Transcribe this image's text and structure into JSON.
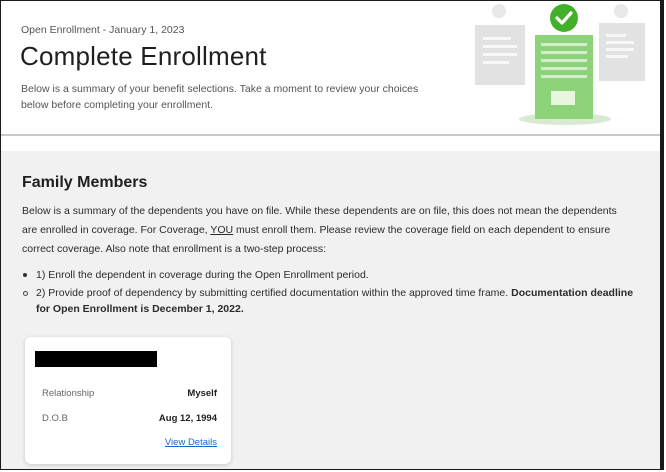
{
  "hero": {
    "eyebrow": "Open Enrollment - January 1, 2023",
    "title": "Complete Enrollment",
    "subtitle": "Below is a summary of your benefit selections. Take a moment to review your choices below before completing your enrollment."
  },
  "family": {
    "heading": "Family Members",
    "intro_1": "Below is a summary of the dependents you have on file. While these dependents are on file, this does not mean the dependents are enrolled in coverage. For Coverage, ",
    "intro_you": "YOU",
    "intro_2": " must  enroll them. Please review the coverage field on each dependent to ensure correct coverage. Also note that enrollment is  a two-step process:",
    "step_1": "1) Enroll the dependent in coverage during the Open Enrollment period.",
    "step_2": "2) Provide proof of dependency by submitting certified documentation within the approved time frame. ",
    "deadline": "Documentation deadline for Open Enrollment is December 1, 2022."
  },
  "member_card": {
    "relationship_label": "Relationship",
    "relationship_value": "Myself",
    "dob_label": "D.O.B",
    "dob_value": "Aug 12, 1994",
    "view_details": "View Details"
  },
  "colors": {
    "accent_green": "#43b02a",
    "link_blue": "#1a66c8",
    "section_bg": "#f1f1f1"
  }
}
